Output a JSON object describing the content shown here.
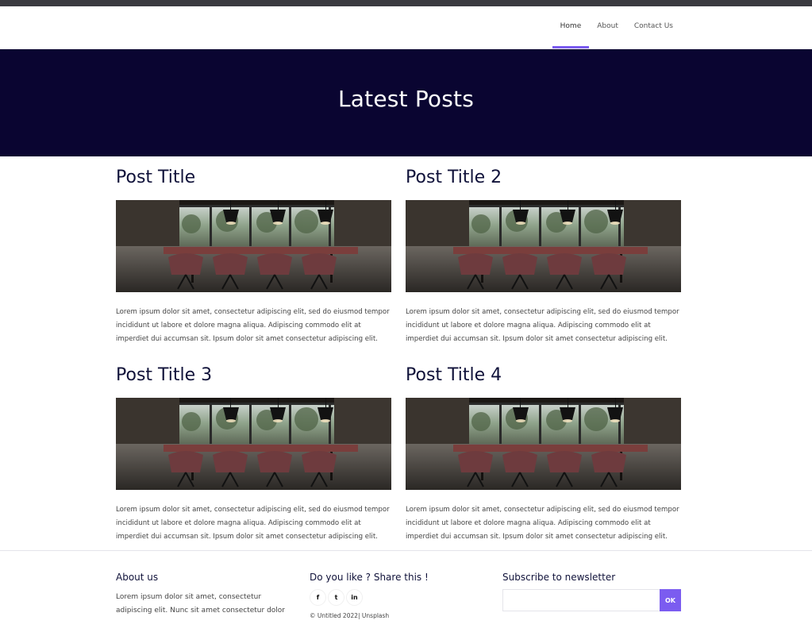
{
  "nav": {
    "items": [
      {
        "label": "Home",
        "active": true
      },
      {
        "label": "About",
        "active": false
      },
      {
        "label": "Contact Us",
        "active": false
      }
    ]
  },
  "hero": {
    "title": "Latest Posts"
  },
  "posts": [
    {
      "title": "Post Title",
      "body": "Lorem ipsum dolor sit amet, consectetur adipiscing elit, sed do eiusmod tempor incididunt ut labore et dolore magna aliqua. Adipiscing commodo elit at imperdiet dui accumsan sit. Ipsum dolor sit amet consectetur adipiscing elit."
    },
    {
      "title": "Post Title 2",
      "body": "Lorem ipsum dolor sit amet, consectetur adipiscing elit, sed do eiusmod tempor incididunt ut labore et dolore magna aliqua. Adipiscing commodo elit at imperdiet dui accumsan sit. Ipsum dolor sit amet consectetur adipiscing elit."
    },
    {
      "title": "Post Title 3",
      "body": "Lorem ipsum dolor sit amet, consectetur adipiscing elit, sed do eiusmod tempor incididunt ut labore et dolore magna aliqua. Adipiscing commodo elit at imperdiet dui accumsan sit. Ipsum dolor sit amet consectetur adipiscing elit."
    },
    {
      "title": "Post Title 4",
      "body": "Lorem ipsum dolor sit amet, consectetur adipiscing elit, sed do eiusmod tempor incididunt ut labore et dolore magna aliqua. Adipiscing commodo elit at imperdiet dui accumsan sit. Ipsum dolor sit amet consectetur adipiscing elit."
    }
  ],
  "footer": {
    "about": {
      "heading": "About us",
      "text": "Lorem ipsum dolor sit amet, consectetur adipiscing elit. Nunc sit amet consectetur dolor"
    },
    "share": {
      "heading": "Do you like ? Share this !",
      "icons": [
        {
          "name": "facebook-icon",
          "glyph": "f"
        },
        {
          "name": "twitter-icon",
          "glyph": "t"
        },
        {
          "name": "linkedin-icon",
          "glyph": "in"
        }
      ],
      "copyright": "© Untitled 2022| Unsplash"
    },
    "newsletter": {
      "heading": "Subscribe to newsletter",
      "input_value": "",
      "button_label": "OK"
    }
  },
  "colors": {
    "hero_bg": "#0a0531",
    "accent": "#7b5cf0",
    "topbar": "#3a3a40"
  }
}
